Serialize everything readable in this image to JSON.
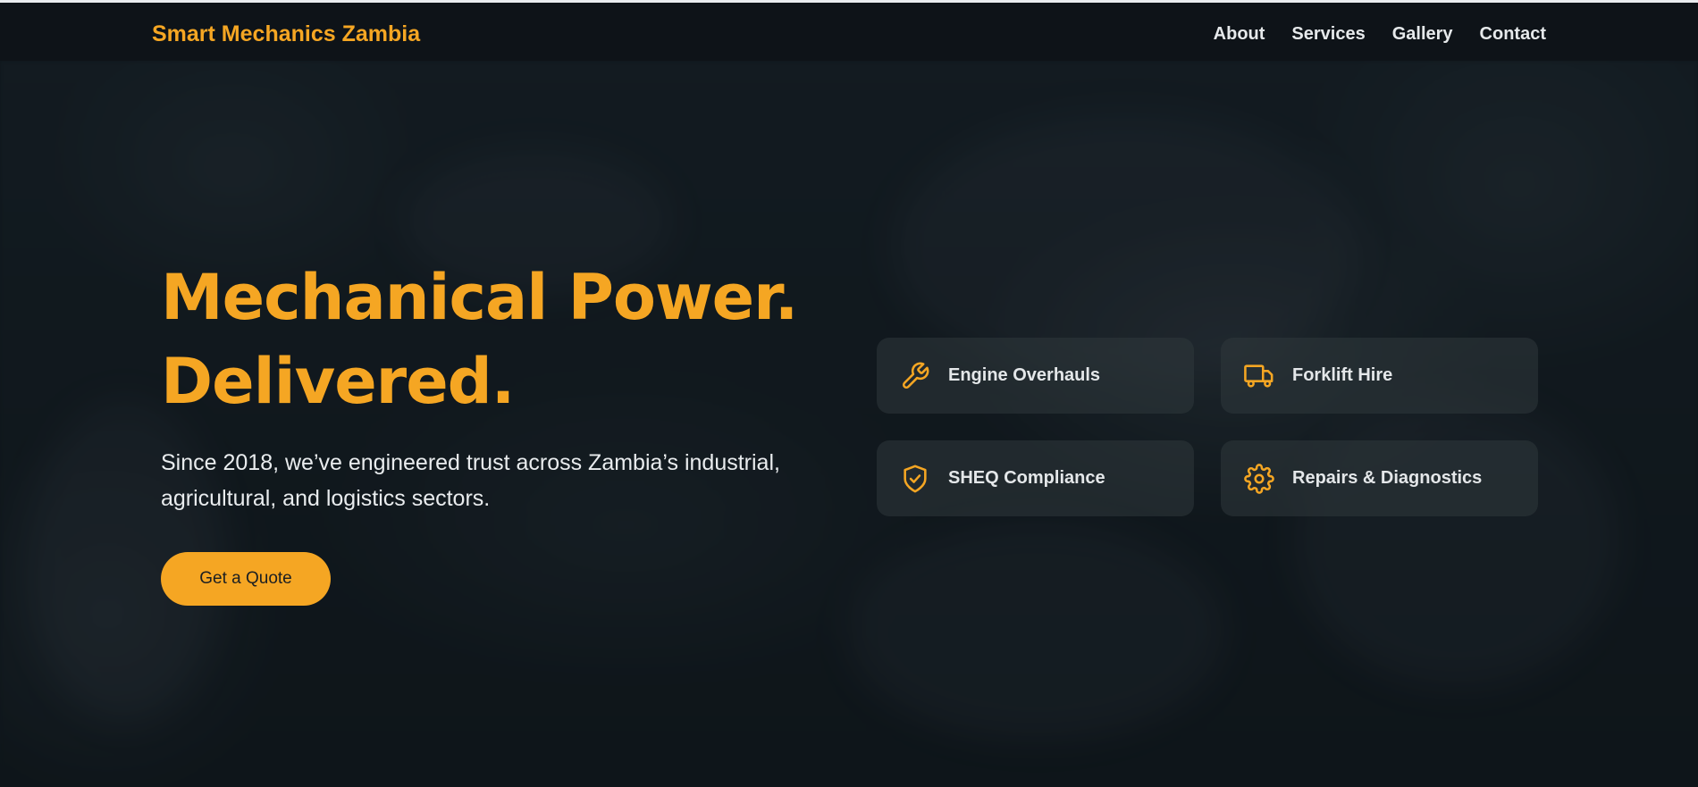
{
  "header": {
    "brand": "Smart Mechanics Zambia",
    "nav": [
      {
        "label": "About"
      },
      {
        "label": "Services"
      },
      {
        "label": "Gallery"
      },
      {
        "label": "Contact"
      }
    ]
  },
  "hero": {
    "title_line1": "Mechanical Power.",
    "title_line2": "Delivered.",
    "subtitle": "Since 2018, we’ve engineered trust across Zambia’s industrial, agricultural, and logistics sectors.",
    "cta_label": "Get a Quote"
  },
  "services": [
    {
      "label": "Engine Overhauls",
      "icon": "wrench-icon"
    },
    {
      "label": "Forklift Hire",
      "icon": "truck-icon"
    },
    {
      "label": "SHEQ Compliance",
      "icon": "shield-check-icon"
    },
    {
      "label": "Repairs & Diagnostics",
      "icon": "gear-icon"
    }
  ],
  "colors": {
    "accent": "#f5a623",
    "background": "#111a1f",
    "card": "#30383d",
    "text": "#e9ecee"
  }
}
